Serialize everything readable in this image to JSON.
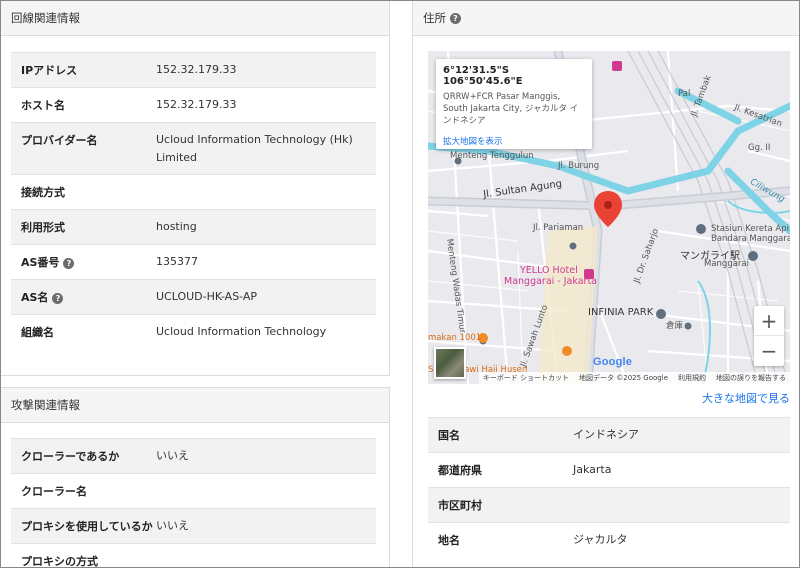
{
  "line_info": {
    "title": "回線関連情報",
    "rows": [
      {
        "key": "IPアドレス",
        "value": "152.32.179.33",
        "help": false
      },
      {
        "key": "ホスト名",
        "value": "152.32.179.33",
        "help": false
      },
      {
        "key": "プロバイダー名",
        "value": "Ucloud Information Technology (Hk) Limited",
        "help": false
      },
      {
        "key": "接続方式",
        "value": "",
        "help": false
      },
      {
        "key": "利用形式",
        "value": "hosting",
        "help": false
      },
      {
        "key": "AS番号",
        "value": "135377",
        "help": true
      },
      {
        "key": "AS名",
        "value": "UCLOUD-HK-AS-AP",
        "help": true
      },
      {
        "key": "組織名",
        "value": "Ucloud Information Technology",
        "help": false
      }
    ]
  },
  "attack_info": {
    "title": "攻撃関連情報",
    "rows": [
      {
        "key": "クローラーであるか",
        "value": "いいえ"
      },
      {
        "key": "クローラー名",
        "value": ""
      },
      {
        "key": "プロキシを使用しているか",
        "value": "いいえ"
      },
      {
        "key": "プロキシの方式",
        "value": ""
      }
    ]
  },
  "address": {
    "title": "住所",
    "help_glyph": "?",
    "map": {
      "popup_coord": "6°12'31.5\"S 106°50'45.6\"E",
      "popup_address": "QRRW+FCR Pasar Manggis, South Jakarta City, ジャカルタ インドネシア",
      "popup_link": "拡大地図を表示",
      "zoom_in": "+",
      "zoom_out": "−",
      "google": "Google",
      "attrib_shortcut": "キーボード ショートカット",
      "attrib_data": "地図データ ©2025 Google",
      "attrib_terms": "利用規約",
      "attrib_report": "地図の誤りを報告する",
      "labels": {
        "menteng_tenggulun": "Menteng Tenggulun",
        "sultan_agung": "Jl. Sultan Agung",
        "pariaman": "Jl. Pariaman",
        "menteng_wadas": "Menteng Wadas Timur",
        "yello1": "YELLO Hotel",
        "yello2": "Manggarai - Jakarta",
        "infinia": "INFINIA PARK",
        "infinia_sub": "倉庫",
        "stasiun1": "Stasiun Kereta Api",
        "stasiun2": "Bandara Manggarai",
        "manggarai_jp": "マンガライ駅",
        "manggarai": "Manggarai",
        "ciliwung": "Ciliwung",
        "sawah_lunto": "Jl. Sawah Lunto",
        "dr_saharjo": "Jl. Dr. Saharjo",
        "tambak": "Jl. Tambak",
        "burung": "Jl. Burung",
        "makan": "makan 1001",
        "soto": "Soto Betawi Haji Husen",
        "kesatrian": "Jl. Kesatrian",
        "pal": "Pal",
        "gang": "Gg. II"
      }
    },
    "larger_map_link": "大きな地図で見る",
    "rows": [
      {
        "key": "国名",
        "value": "インドネシア"
      },
      {
        "key": "都道府県",
        "value": "Jakarta"
      },
      {
        "key": "市区町村",
        "value": ""
      },
      {
        "key": "地名",
        "value": "ジャカルタ"
      }
    ]
  },
  "colors": {
    "header_bg": "#f5f5f5",
    "row_alt": "#f2f2f2",
    "link": "#1a73e8",
    "river": "#7fd3e6",
    "pin": "#ea4335",
    "poi": "#d0398e"
  },
  "icons": {
    "help": "question-circle-icon",
    "pin": "map-pin-icon",
    "zoom_in": "plus-icon",
    "zoom_out": "minus-icon"
  }
}
